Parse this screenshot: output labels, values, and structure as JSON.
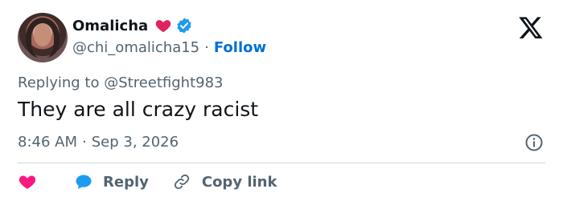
{
  "author": {
    "name": "Omalicha",
    "handle": "@chi_omalicha15",
    "separator": "·",
    "follow_label": "Follow"
  },
  "reply": {
    "prefix": "Replying to",
    "target": "@Streetfight983"
  },
  "tweet": {
    "text": "They are all crazy racist",
    "time": "8:46 AM",
    "separator": "·",
    "date": "Sep 3, 2026"
  },
  "actions": {
    "reply_label": "Reply",
    "copy_link_label": "Copy link"
  },
  "icons": {
    "name_emoji": "heart-icon",
    "badge": "verified-icon",
    "logo": "x-logo-icon",
    "info": "info-icon",
    "like": "heart-icon",
    "reply": "speech-bubble-icon",
    "link": "link-icon"
  },
  "colors": {
    "heart": "#e0245e",
    "like": "#f91880",
    "verified": "#1d9bf0",
    "reply_bubble": "#1d9bf0",
    "follow": "#006fd6",
    "secondary_text": "#536471"
  }
}
